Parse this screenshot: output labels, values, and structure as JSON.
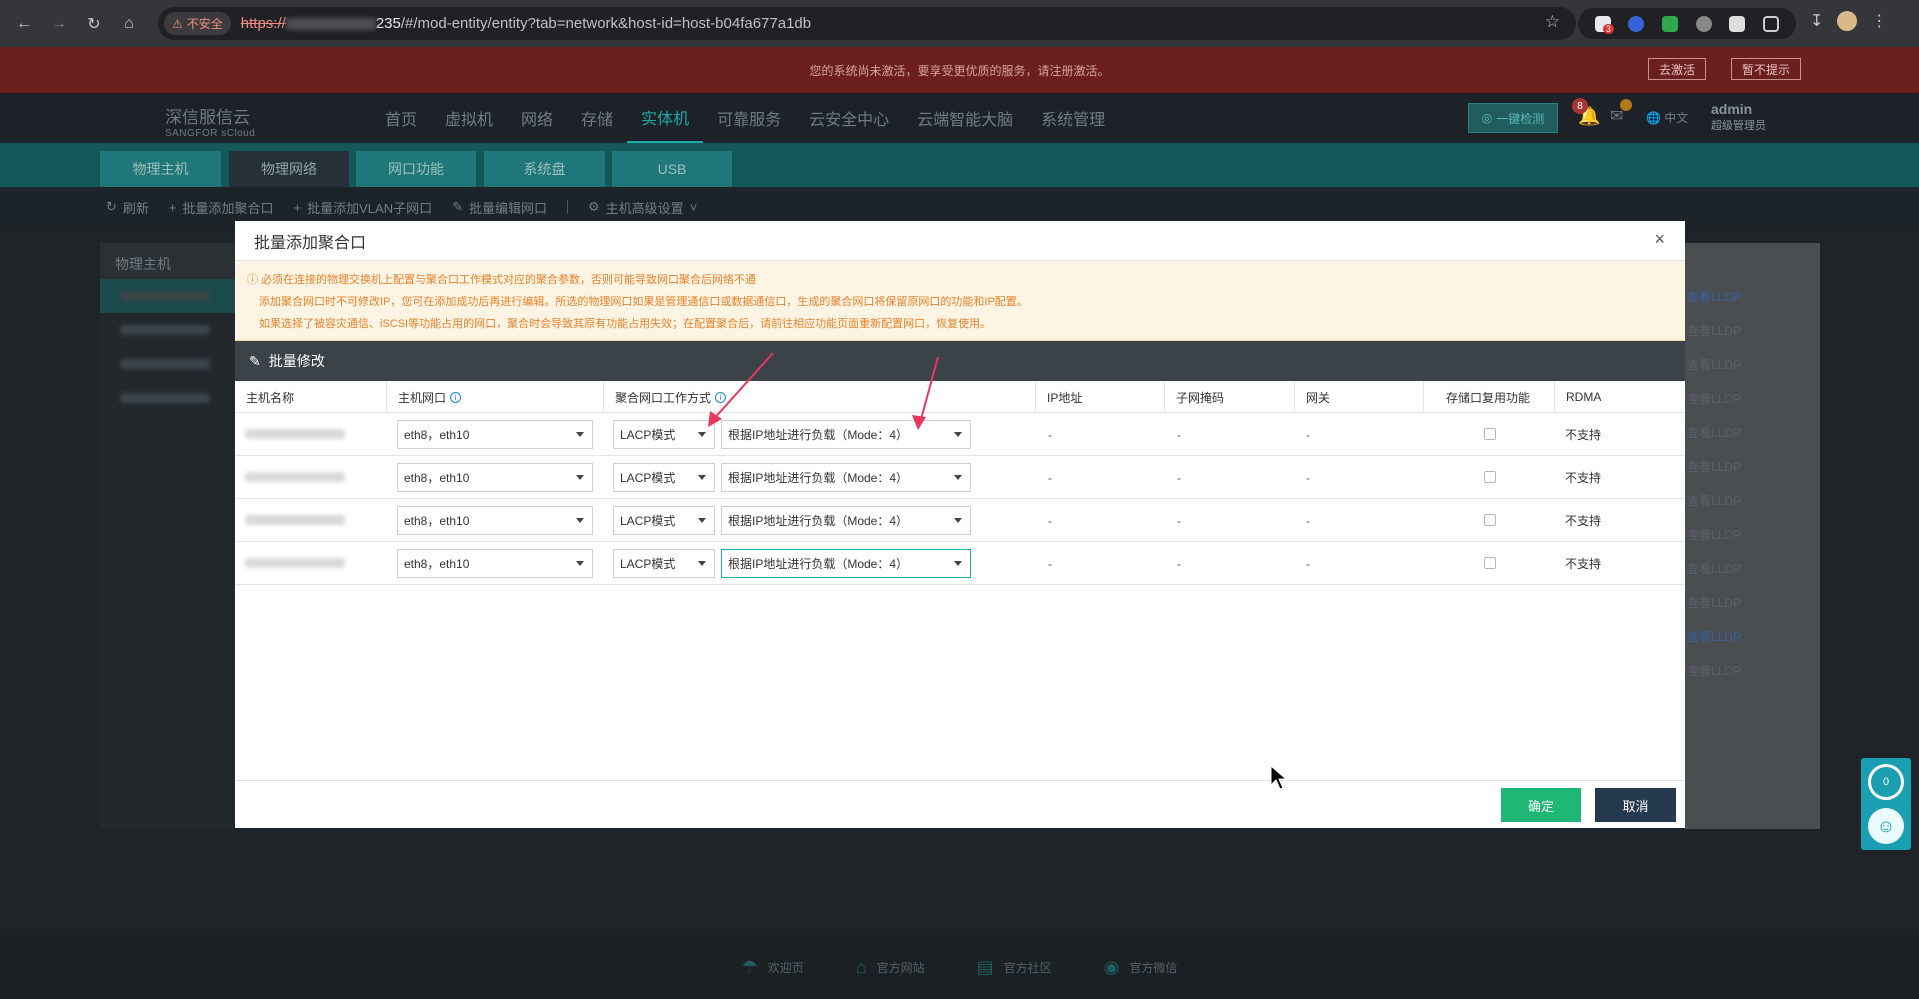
{
  "browser": {
    "insecure_label": "不安全",
    "url_proto": "https://",
    "url_host": "235",
    "url_path": "/#/mod-entity/entity?tab=network&host-id=host-b04fa677a1db",
    "ext_badge": "3"
  },
  "notice": {
    "text": "您的系统尚未激活，要享受更优质的服务，请注册激活。",
    "activate_label": "去激活",
    "dismiss_label": "暂不提示"
  },
  "header": {
    "logo_cn": "深信服信云",
    "logo_en": "SANGFOR sCloud",
    "menu": [
      "首页",
      "虚拟机",
      "网络",
      "存储",
      "实体机",
      "可靠服务",
      "云安全中心",
      "云端智能大脑",
      "系统管理"
    ],
    "detect_label": "一键检测",
    "bell_count": "8",
    "lang": "中文",
    "user_name": "admin",
    "user_role": "超级管理员"
  },
  "subtabs": [
    "物理主机",
    "物理网络",
    "网口功能",
    "系统盘",
    "USB"
  ],
  "toolbar": {
    "refresh": "刷新",
    "add_bond": "批量添加聚合口",
    "add_vlan": "批量添加VLAN子网口",
    "edit_ports": "批量编辑网口",
    "advanced": "主机高级设置"
  },
  "left_panel": {
    "title": "物理主机"
  },
  "right_col": {
    "lldp_label": "查看LLDP"
  },
  "modal": {
    "title": "批量添加聚合口",
    "warning": [
      "必须在连接的物理交换机上配置与聚合口工作模式对应的聚合参数，否则可能导致网口聚合后网络不通",
      "添加聚合网口时不可修改IP，您可在添加成功后再进行编辑。所选的物理网口如果是管理通信口或数据通信口，生成的聚合网口将保留原网口的功能和IP配置。",
      "如果选择了被容灾通信、iSCSI等功能占用的网口，聚合时会导致其原有功能占用失效；在配置聚合后，请前往相应功能页面重新配置网口，恢复使用。"
    ],
    "bulk_label": "批量修改",
    "columns": [
      "主机名称",
      "主机网口",
      "聚合网口工作方式",
      "",
      "IP地址",
      "子网掩码",
      "网关",
      "存储口复用功能",
      "RDMA"
    ],
    "rows": [
      {
        "ports": "eth8，eth10",
        "mode": "LACP模式",
        "balance": "根据IP地址进行负载（Mode：4）",
        "ip": "-",
        "mask": "-",
        "gw": "-",
        "rdma": "不支持"
      },
      {
        "ports": "eth8，eth10",
        "mode": "LACP模式",
        "balance": "根据IP地址进行负载（Mode：4）",
        "ip": "-",
        "mask": "-",
        "gw": "-",
        "rdma": "不支持"
      },
      {
        "ports": "eth8，eth10",
        "mode": "LACP模式",
        "balance": "根据IP地址进行负载（Mode：4）",
        "ip": "-",
        "mask": "-",
        "gw": "-",
        "rdma": "不支持"
      },
      {
        "ports": "eth8，eth10",
        "mode": "LACP模式",
        "balance": "根据IP地址进行负载（Mode：4）",
        "ip": "-",
        "mask": "-",
        "gw": "-",
        "rdma": "不支持"
      }
    ],
    "ok_label": "确定",
    "cancel_label": "取消"
  },
  "footer": [
    "欢迎页",
    "官方网站",
    "官方社区",
    "官方微信"
  ],
  "widget": {
    "count": "0"
  },
  "colors": {
    "accent": "#1fa8a8",
    "ok": "#1fb776",
    "cancel": "#25394f",
    "warn_text": "#e8822c",
    "arrow": "#e8365d"
  }
}
